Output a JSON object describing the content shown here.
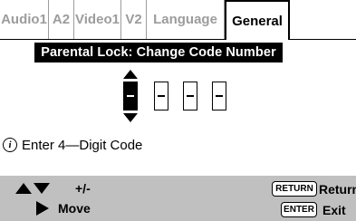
{
  "tabs": [
    {
      "label": "Audio1",
      "active": false
    },
    {
      "label": "A2",
      "active": false
    },
    {
      "label": "Video1",
      "active": false
    },
    {
      "label": "V2",
      "active": false
    },
    {
      "label": "Language",
      "active": false
    },
    {
      "label": "General",
      "active": true
    }
  ],
  "panel": {
    "title": "Parental Lock: Change Code Number"
  },
  "code_entry": {
    "digits": [
      "–",
      "–",
      "–",
      "–"
    ],
    "selected_index": 0
  },
  "info": {
    "icon": "info-icon",
    "text": "Enter 4—Digit Code"
  },
  "footer": {
    "adjust_label": "+/-",
    "move_label": "Move",
    "return_key": "RETURN",
    "return_label": "Return",
    "enter_key": "ENTER",
    "exit_label": "Exit"
  },
  "colors": {
    "tab_inactive_text": "#9c9c9c",
    "title_bar_bg": "#000000",
    "footer_bg": "#c0c0c0"
  }
}
